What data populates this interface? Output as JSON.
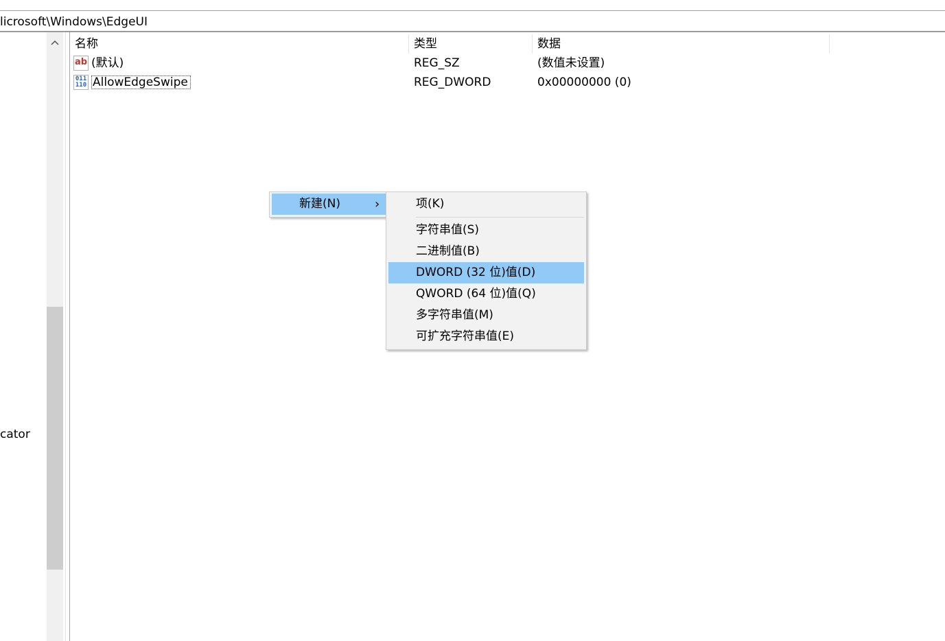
{
  "address_bar": {
    "path": "licrosoft\\Windows\\EdgeUI"
  },
  "tree": {
    "partial_label": "cator",
    "scroll_up_icon": "chevron-up-icon"
  },
  "list": {
    "headers": {
      "name": "名称",
      "type": "类型",
      "data": "数据"
    },
    "rows": [
      {
        "icon": "string-value-icon",
        "icon_text": "ab",
        "name": "(默认)",
        "type": "REG_SZ",
        "data": "(数值未设置)"
      },
      {
        "icon": "binary-value-icon",
        "icon_text": "011\n110",
        "name": "AllowEdgeSwipe",
        "type": "REG_DWORD",
        "data": "0x00000000 (0)"
      }
    ]
  },
  "context_menu": {
    "new_label": "新建(N)",
    "arrow": "›"
  },
  "submenu": {
    "items": [
      {
        "label": "项(K)"
      },
      {
        "label": "字符串值(S)"
      },
      {
        "label": "二进制值(B)"
      },
      {
        "label": "DWORD (32 位)值(D)",
        "highlighted": true
      },
      {
        "label": "QWORD (64 位)值(Q)"
      },
      {
        "label": "多字符串值(M)"
      },
      {
        "label": "可扩充字符串值(E)"
      }
    ]
  },
  "colors": {
    "highlight": "#91c9f7",
    "menu_bg": "#f2f2f2",
    "scroll_thumb": "#cdcdcd"
  }
}
